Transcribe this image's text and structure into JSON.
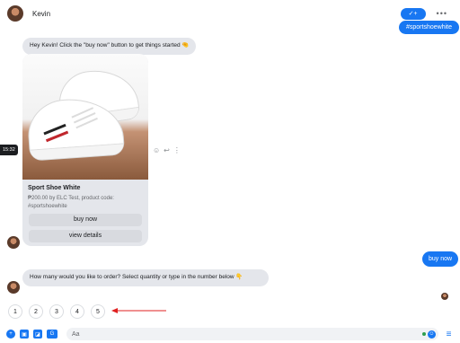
{
  "header": {
    "name": "Kevin",
    "pill_label": "✓+",
    "more_label": "•••"
  },
  "messages": {
    "tag_bubble": "#sportshoewhite",
    "greeting": "Hey Kevin! Click the \"buy now\" button to get things started 🤏",
    "timestamp": "15:32",
    "buy_now_bubble": "buy now",
    "quantity_prompt": "How many would you like to order? Select quantity or type in the number below 👇"
  },
  "card": {
    "title": "Sport Shoe White",
    "subtitle_line1": "₱200.00 by ELC Test, product code:",
    "subtitle_line2": "#sportshoewhite",
    "buttons": [
      "buy now",
      "view details"
    ]
  },
  "quick_replies": [
    "1",
    "2",
    "3",
    "4",
    "5"
  ],
  "composer": {
    "placeholder": "Aa"
  },
  "colors": {
    "accent": "#1877f2",
    "bubble_gray": "#e4e6eb",
    "arrow_red": "#e02020"
  },
  "icons": {
    "header": [
      "check-add-icon",
      "more-icon"
    ],
    "reactions": [
      "emoji-react-icon",
      "reply-icon",
      "more-vertical-icon"
    ],
    "composer": [
      "plus-icon",
      "image-icon",
      "sticker-icon",
      "gif-icon",
      "emoji-icon",
      "menu-icon"
    ]
  }
}
